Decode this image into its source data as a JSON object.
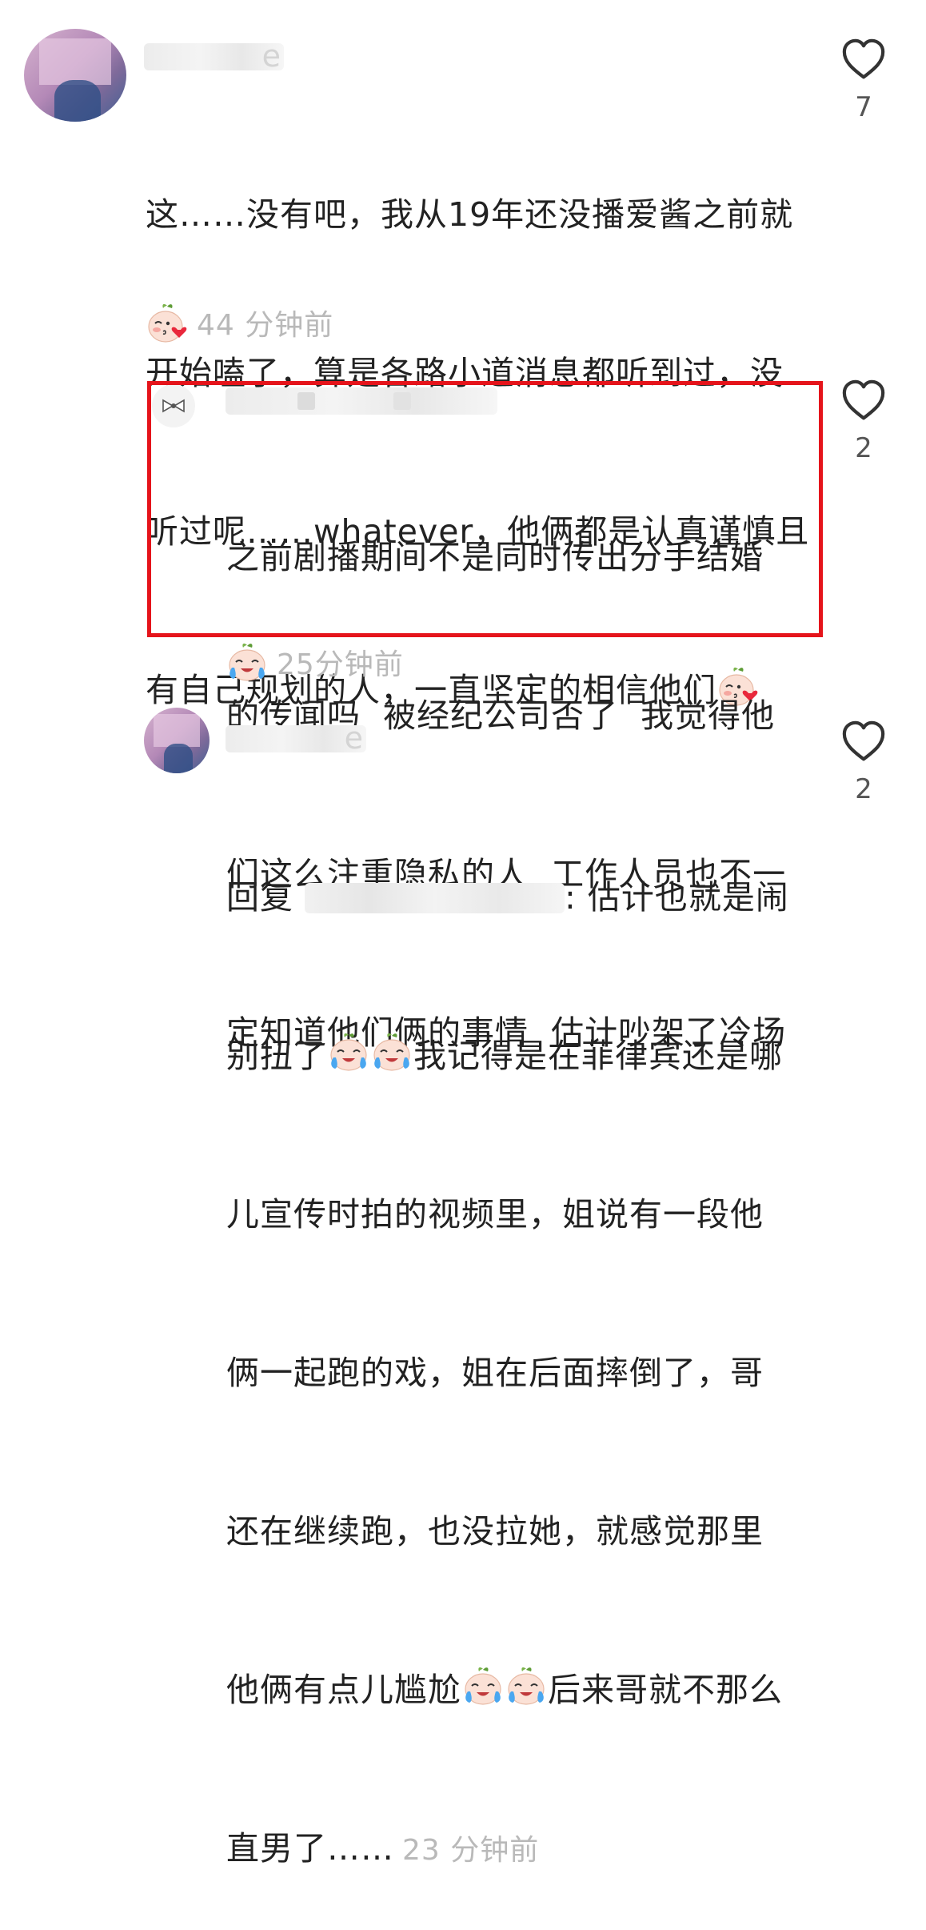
{
  "comments": [
    {
      "username_hidden_hint": "e",
      "text_lines": [
        "这……没有吧，我从19年还没播爱酱之前就",
        "开始嗑了，算是各路小道消息都听到过，没",
        "听过呢……whatever，他俩都是认真谨慎且",
        "有自己规划的人，一直坚定的相信他们"
      ],
      "time": "44 分钟前",
      "likes": "7"
    },
    {
      "text_lines": [
        "之前剧播期间不是同时传出分手结婚",
        "的传闻吗  被经纪公司否了  我觉得他",
        "们这么注重隐私的人  工作人员也不一",
        "定知道他们俩的事情  估计吵架了冷场"
      ],
      "time": "25分钟前",
      "likes": "2"
    },
    {
      "username_hidden_hint": "e",
      "reply_prefix": "回复",
      "reply_suffix": ": 估计也就是闹",
      "text_lines": [
        "别扭了",
        "我记得是在菲律宾还是哪",
        "儿宣传时拍的视频里，姐说有一段他",
        "俩一起跑的戏，姐在后面摔倒了，哥",
        "还在继续跑，也没拉她，就感觉那里",
        "他俩有点儿尴尬",
        "后来哥就不那么",
        "直男了……"
      ],
      "time": "23 分钟前",
      "likes": "2"
    }
  ],
  "icons": {
    "like": "heart-outline-icon",
    "emoji_kiss": "peach-kiss-emoji",
    "emoji_cry": "peach-crying-emoji"
  },
  "colors": {
    "highlight": "#e5141b",
    "time": "#b9b9b9"
  }
}
